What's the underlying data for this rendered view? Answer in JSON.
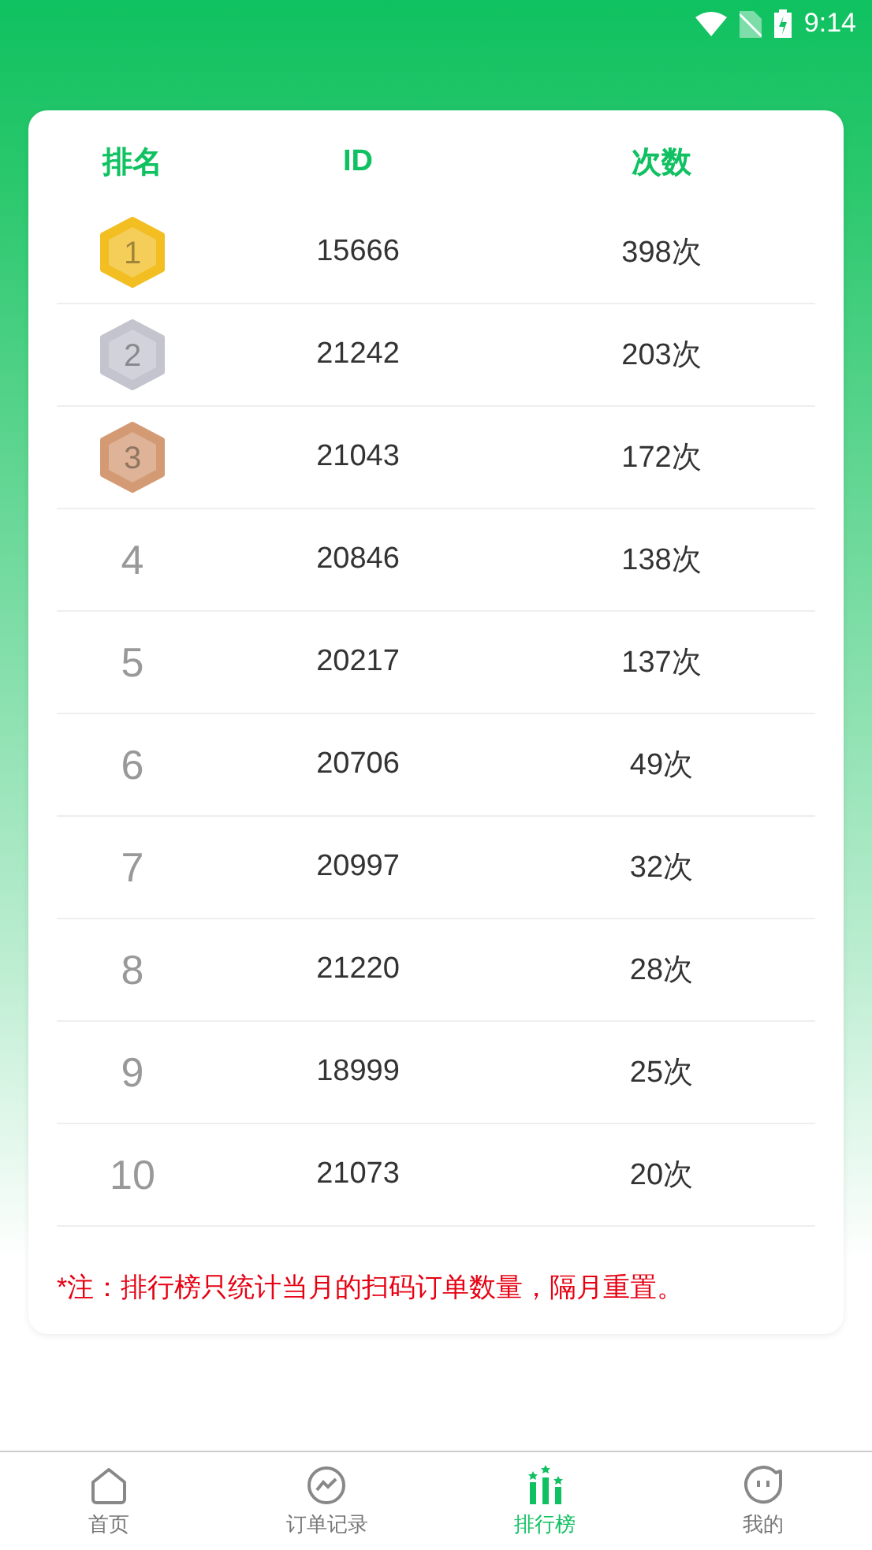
{
  "status_bar": {
    "time": "9:14"
  },
  "table": {
    "columns": [
      "排名",
      "ID",
      "次数"
    ],
    "rows": [
      {
        "kind": "medal",
        "rank": "1",
        "color": "#f2be22",
        "id": "15666",
        "count": "398次"
      },
      {
        "kind": "medal",
        "rank": "2",
        "color": "#c3c4ce",
        "id": "21242",
        "count": "203次"
      },
      {
        "kind": "medal",
        "rank": "3",
        "color": "#d39a74",
        "id": "21043",
        "count": "172次"
      },
      {
        "kind": "plain",
        "rank": "4",
        "id": "20846",
        "count": "138次"
      },
      {
        "kind": "plain",
        "rank": "5",
        "id": "20217",
        "count": "137次"
      },
      {
        "kind": "plain",
        "rank": "6",
        "id": "20706",
        "count": "49次"
      },
      {
        "kind": "plain",
        "rank": "7",
        "id": "20997",
        "count": "32次"
      },
      {
        "kind": "plain",
        "rank": "8",
        "id": "21220",
        "count": "28次"
      },
      {
        "kind": "plain",
        "rank": "9",
        "id": "18999",
        "count": "25次"
      },
      {
        "kind": "plain",
        "rank": "10",
        "id": "21073",
        "count": "20次"
      }
    ]
  },
  "note": "*注：排行榜只统计当月的扫码订单数量，隔月重置。",
  "nav": [
    {
      "kind": "home",
      "label": "首页",
      "selected": false
    },
    {
      "kind": "orders",
      "label": "订单记录",
      "selected": false
    },
    {
      "kind": "ranking",
      "label": "排行榜",
      "selected": true
    },
    {
      "kind": "me",
      "label": "我的",
      "selected": false
    }
  ]
}
